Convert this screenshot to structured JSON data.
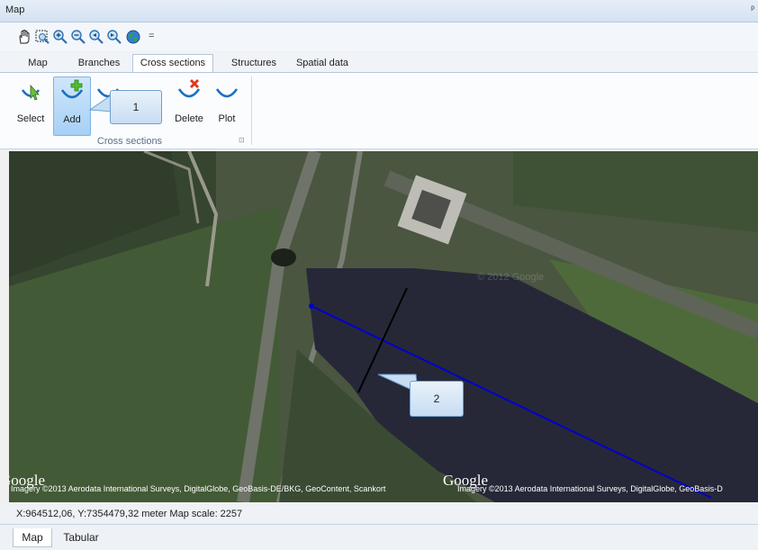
{
  "window": {
    "title": "Map",
    "pin_glyph": "ᵖ"
  },
  "toolbar": {
    "icons": [
      "pan-icon",
      "zoom-box-icon",
      "zoom-in-icon",
      "zoom-out-icon",
      "zoom-previous-icon",
      "zoom-next-icon",
      "globe-icon"
    ],
    "overflow_glyph": "="
  },
  "tabs": [
    {
      "label": "Map",
      "active": false
    },
    {
      "label": "Branches",
      "active": false
    },
    {
      "label": "Cross sections",
      "active": true
    },
    {
      "label": "Structures",
      "active": false
    },
    {
      "label": "Spatial data",
      "active": false
    }
  ],
  "ribbon": {
    "buttons": [
      {
        "label": "Select",
        "icon": "select-cursor-icon"
      },
      {
        "label": "Add",
        "icon": "add-cross-section-icon",
        "selected": true
      },
      {
        "label": "Delete",
        "icon": "delete-cross-section-icon"
      },
      {
        "label": "Plot",
        "icon": "plot-cross-section-icon"
      }
    ],
    "group_label": "Cross sections",
    "launcher_glyph": "⊡"
  },
  "callouts": [
    {
      "number": "1"
    },
    {
      "number": "2"
    }
  ],
  "map": {
    "google_logo": "Google",
    "attribution_left": "Imagery ©2013 Aerodata International Surveys, DigitalGlobe, GeoBasis-DE/BKG, GeoContent, Scankort",
    "attribution_right": "Imagery ©2013 Aerodata International Surveys, DigitalGlobe, GeoBasis-D",
    "watermark": "© 2012 Google",
    "colors": {
      "branch_line": "#0000cc",
      "cross_section": "#000000"
    }
  },
  "status": {
    "coords": "X:964512,06,   Y:7354479,32   meter   Map scale: 2257"
  },
  "bottom_tabs": [
    {
      "label": "Map",
      "active": true
    },
    {
      "label": "Tabular",
      "active": false
    }
  ]
}
